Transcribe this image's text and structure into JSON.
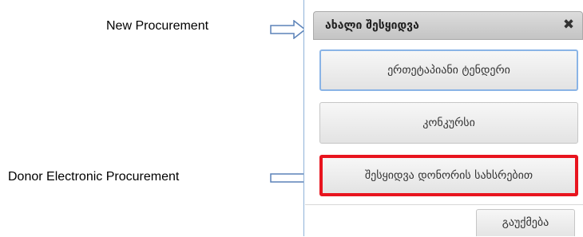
{
  "annotations": {
    "new_procurement": "New Procurement",
    "donor_procurement": "Donor Electronic Procurement"
  },
  "dialog": {
    "title": "ახალი შესყიდვა",
    "close_glyph": "✖",
    "options": [
      {
        "label": "ერთეტაპიანი ტენდერი"
      },
      {
        "label": "კონკურსი"
      },
      {
        "label": "შესყიდვა დონორის სახსრებით"
      }
    ],
    "cancel_label": "გაუქმება"
  },
  "colors": {
    "highlight_border": "#e8141e",
    "focus_border": "#8ab4e6",
    "arrow_stroke": "#5b82b8"
  }
}
